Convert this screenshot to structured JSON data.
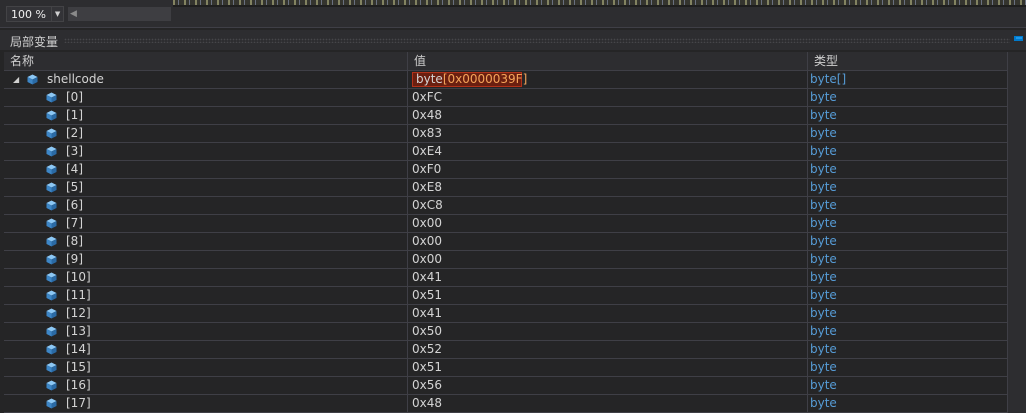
{
  "toolbar": {
    "zoom": "100 %"
  },
  "panel": {
    "title": "局部变量"
  },
  "columns": {
    "name": "名称",
    "value": "值",
    "type": "类型"
  },
  "parent": {
    "name": "shellcode",
    "value_type": "byte",
    "value_bracket": "[0x0000039F]",
    "type": "byte[]"
  },
  "items": [
    {
      "name": "[0]",
      "value": "0xFC",
      "type": "byte"
    },
    {
      "name": "[1]",
      "value": "0x48",
      "type": "byte"
    },
    {
      "name": "[2]",
      "value": "0x83",
      "type": "byte"
    },
    {
      "name": "[3]",
      "value": "0xE4",
      "type": "byte"
    },
    {
      "name": "[4]",
      "value": "0xF0",
      "type": "byte"
    },
    {
      "name": "[5]",
      "value": "0xE8",
      "type": "byte"
    },
    {
      "name": "[6]",
      "value": "0xC8",
      "type": "byte"
    },
    {
      "name": "[7]",
      "value": "0x00",
      "type": "byte"
    },
    {
      "name": "[8]",
      "value": "0x00",
      "type": "byte"
    },
    {
      "name": "[9]",
      "value": "0x00",
      "type": "byte"
    },
    {
      "name": "[10]",
      "value": "0x41",
      "type": "byte"
    },
    {
      "name": "[11]",
      "value": "0x51",
      "type": "byte"
    },
    {
      "name": "[12]",
      "value": "0x41",
      "type": "byte"
    },
    {
      "name": "[13]",
      "value": "0x50",
      "type": "byte"
    },
    {
      "name": "[14]",
      "value": "0x52",
      "type": "byte"
    },
    {
      "name": "[15]",
      "value": "0x51",
      "type": "byte"
    },
    {
      "name": "[16]",
      "value": "0x56",
      "type": "byte"
    },
    {
      "name": "[17]",
      "value": "0x48",
      "type": "byte"
    }
  ],
  "colors": {
    "background": "#252526",
    "header": "#2d2d30",
    "gridline": "#3f3f46",
    "type_text": "#569cd6",
    "changed_bg": "#6b1f10",
    "changed_border": "#b2321a",
    "icon_cube": "#5aa9e6"
  },
  "icons": {
    "expander": "collapse-triangle-icon",
    "variable": "field-cube-icon",
    "zoom_dropdown": "chevron-down-icon",
    "scroll_left": "scroll-left-arrow-icon",
    "pin": "pin-icon"
  }
}
